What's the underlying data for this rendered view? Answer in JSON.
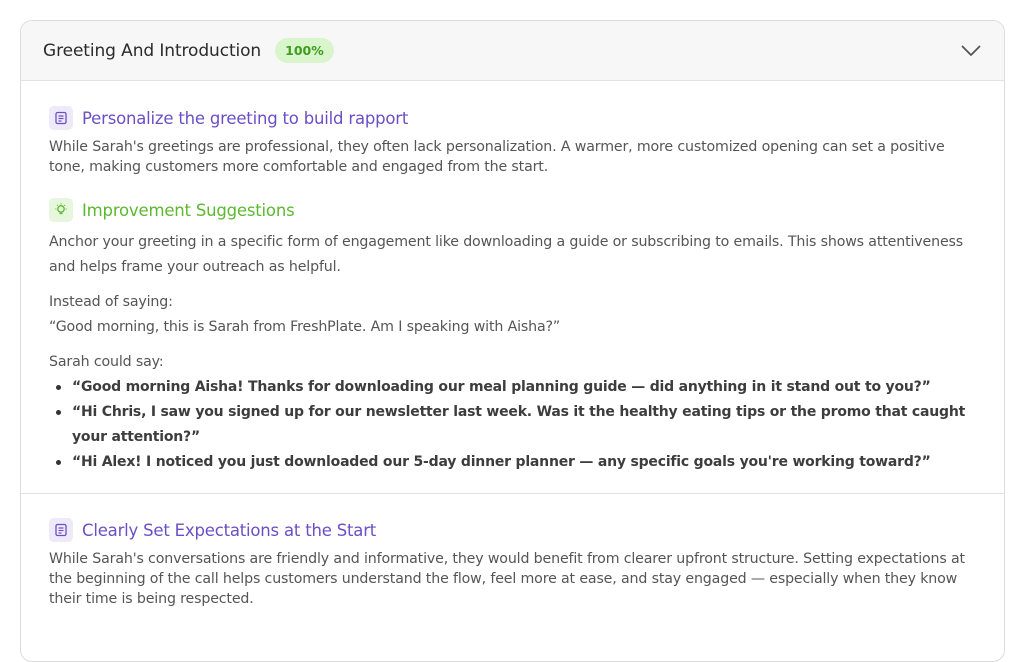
{
  "header": {
    "title": "Greeting And Introduction",
    "badge": "100%",
    "toggle_icon": "chevron-down-icon"
  },
  "section1": {
    "icon": "note-icon",
    "title": "Personalize the greeting to build rapport",
    "description": "While Sarah's greetings are professional, they often lack personalization. A warmer, more customized opening can set a positive tone, making customers more comfortable and engaged from the start.",
    "suggestions": {
      "icon": "lightbulb-icon",
      "title": "Improvement Suggestions",
      "text": "Anchor your greeting in a specific form of engagement like downloading a guide or subscribing to emails. This shows attentiveness and helps frame your outreach as helpful.",
      "instead_label": "Instead of saying:",
      "instead_quote": "“Good morning, this is Sarah from FreshPlate. Am I speaking with Aisha?”",
      "could_say_label": "Sarah could say:",
      "examples": [
        "“Good morning Aisha! Thanks for downloading our meal planning guide — did anything in it stand out to you?”",
        "“Hi Chris, I saw you signed up for our newsletter last week. Was it the healthy eating tips or the promo that caught your attention?”",
        "“Hi Alex! I noticed you just downloaded our 5-day dinner planner — any specific goals you're working toward?”"
      ]
    }
  },
  "section2": {
    "icon": "note-icon",
    "title": "Clearly Set Expectations at the Start",
    "description": "While Sarah's conversations are friendly and informative, they would benefit from clearer upfront structure. Setting expectations at the beginning of the call helps customers understand the flow, feel more at ease, and stay engaged — especially when they know their time is being respected."
  },
  "colors": {
    "purple": "#6b4fc4",
    "green": "#5cb82f",
    "badge_bg": "#d9f5cc",
    "badge_text": "#3e9c1e"
  }
}
